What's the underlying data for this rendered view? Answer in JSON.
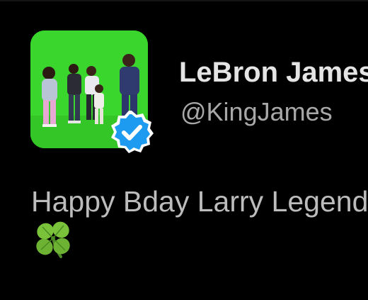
{
  "profile": {
    "display_name": "LeBron James",
    "handle": "@KingJames",
    "avatar_icon": "profile-photo",
    "verified_icon": "verified-badge-icon",
    "verified_color": "#1d9bf0"
  },
  "tweet": {
    "text": "Happy Bday Larry Legend",
    "emoji_icon": "four-leaf-clover-icon"
  },
  "colors": {
    "background": "#000000",
    "name": "#e4e4e4",
    "handle": "#a8a8a8",
    "body_text": "#bcbcbc",
    "avatar_backdrop": "#39d12c"
  }
}
